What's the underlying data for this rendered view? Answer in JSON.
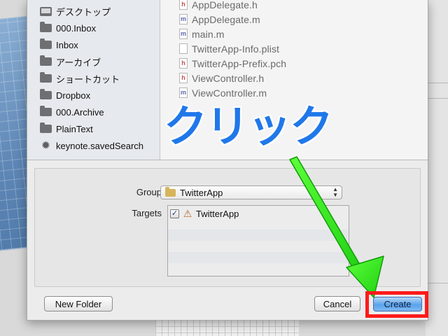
{
  "sidebar": {
    "items": [
      {
        "label": "デスクトップ",
        "icon": "desktop-icon"
      },
      {
        "label": "000.Inbox",
        "icon": "folder-icon"
      },
      {
        "label": "Inbox",
        "icon": "folder-icon"
      },
      {
        "label": "アーカイブ",
        "icon": "folder-icon"
      },
      {
        "label": "ショートカット",
        "icon": "folder-icon"
      },
      {
        "label": "Dropbox",
        "icon": "folder-icon"
      },
      {
        "label": "000.Archive",
        "icon": "folder-icon"
      },
      {
        "label": "PlainText",
        "icon": "folder-icon"
      },
      {
        "label": "keynote.savedSearch",
        "icon": "gear-icon"
      }
    ]
  },
  "files": [
    {
      "name": "AppDelegate.h",
      "type": "h"
    },
    {
      "name": "AppDelegate.m",
      "type": "m"
    },
    {
      "name": "main.m",
      "type": "m"
    },
    {
      "name": "TwitterApp-Info.plist",
      "type": "plist"
    },
    {
      "name": "TwitterApp-Prefix.pch",
      "type": "h"
    },
    {
      "name": "ViewController.h",
      "type": "h"
    },
    {
      "name": "ViewController.m",
      "type": "m"
    }
  ],
  "options": {
    "group_label": "Group",
    "group_value": "TwitterApp",
    "targets_label": "Targets",
    "targets": [
      {
        "name": "TwitterApp",
        "checked": true
      }
    ]
  },
  "buttons": {
    "new_folder": "New Folder",
    "cancel": "Cancel",
    "create": "Create"
  },
  "annotation": {
    "text": "クリック",
    "text_color": "#1f78ea",
    "arrow_color": "#33e61f",
    "highlight_color": "#ff1a1a"
  },
  "background": {
    "faint_cancel": "Cancel"
  },
  "icons": {
    "check": "✓",
    "chevron": "▲▼",
    "app": "⚠"
  }
}
